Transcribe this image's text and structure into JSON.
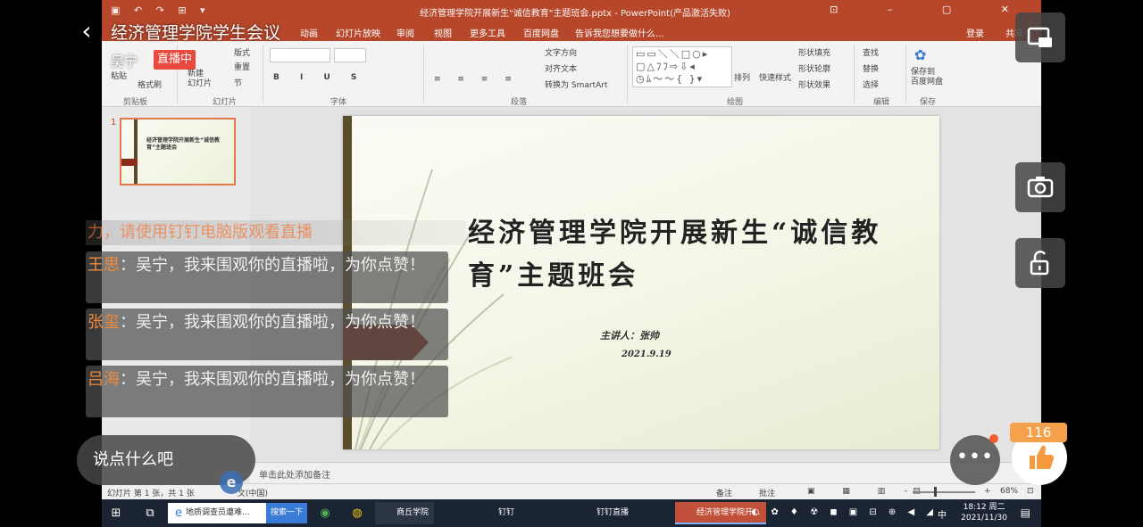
{
  "live": {
    "meeting_title": "经济管理学院学生会议",
    "host_name": "吴宁",
    "live_badge": "直播中",
    "warning": "力，请使用钉钉电脑版观看直播",
    "say_placeholder": "说点什么吧",
    "like_count": "116",
    "comments": [
      {
        "user": "王思",
        "text": "：吴宁，我来围观你的直播啦，为你点赞！"
      },
      {
        "user": "张玺",
        "text": "：吴宁，我来围观你的直播啦，为你点赞！"
      },
      {
        "user": "吕海",
        "text": "：吴宁，我来围观你的直播啦，为你点赞！"
      }
    ],
    "icons": {
      "back": "back-chevron-icon",
      "fullscreen": "fullscreen-icon",
      "camera": "camera-icon",
      "unlock": "unlock-icon",
      "more": "more-icon",
      "like": "thumbs-up-icon"
    }
  },
  "ppt": {
    "window_title": "经济管理学院开展新生\"诚信教育\"主题班会.pptx - PowerPoint(产品激活失败)",
    "tabs": [
      "动画",
      "幻灯片放映",
      "审阅",
      "视图",
      "更多工具",
      "百度网盘",
      "告诉我您想要做什么..."
    ],
    "account": "登录",
    "share": "共享",
    "ribbon": {
      "paste": "粘贴",
      "format_painter": "格式刷",
      "clipboard": "剪贴板",
      "new_slide": "新建\n幻灯片",
      "layout": "版式",
      "reset": "重置",
      "section": "节",
      "slides": "幻灯片",
      "font": "字体",
      "text_direction": "文字方向",
      "align_text": "对齐文本",
      "smartart": "转换为 SmartArt",
      "paragraph": "段落",
      "arrange": "排列",
      "quick_styles": "快速样式",
      "shape_fill": "形状填充",
      "shape_outline": "形状轮廓",
      "shape_effects": "形状效果",
      "drawing": "绘图",
      "find": "查找",
      "replace": "替换",
      "select": "选择",
      "editing": "编辑",
      "save_baidu": "保存到\n百度网盘",
      "save": "保存"
    },
    "slide_number": "1",
    "slide": {
      "title": "经济管理学院开展新生“诚信教育”主题班会",
      "presenter": "主讲人：张帅",
      "date": "2021.9.19"
    },
    "notes_placeholder": "单击此处添加备注",
    "status": {
      "slide_info": "幻灯片 第 1 张，共 1 张",
      "language": "文(中国)",
      "notes": "备注",
      "comments": "批注",
      "zoom": "68%"
    }
  },
  "taskbar": {
    "search_text": "地质调查员遭难...",
    "search_button": "搜索一下",
    "apps": [
      "商丘学院",
      "钉钉",
      "钉钉直播",
      "经济管理学院开..."
    ],
    "time": "18:12 周二",
    "date": "2021/11/30",
    "ime": "中"
  }
}
